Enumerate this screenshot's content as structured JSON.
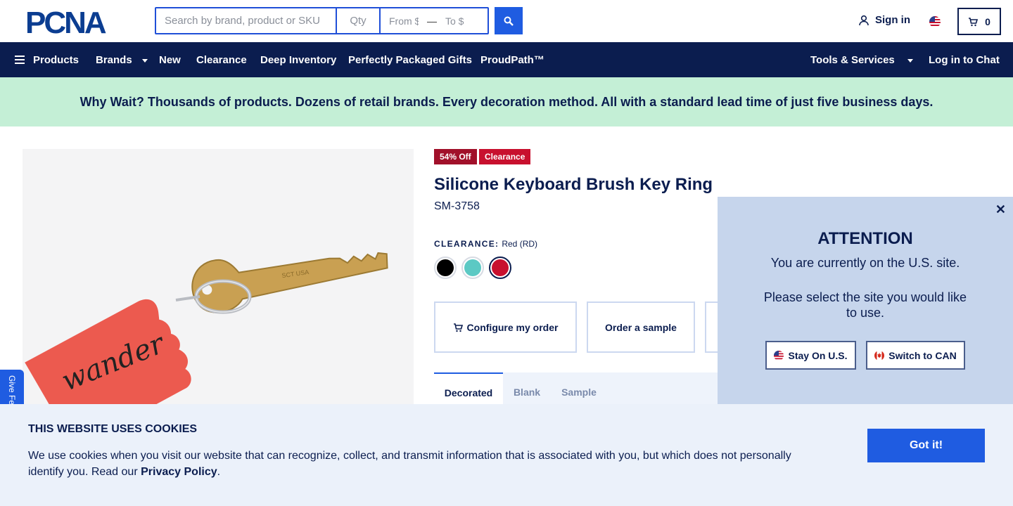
{
  "header": {
    "logo_text": "PCNA",
    "search_placeholder": "Search by brand, product or SKU",
    "qty_placeholder": "Qty",
    "from_placeholder": "From $",
    "range_separator": "—",
    "to_placeholder": "To $",
    "signin_label": "Sign in",
    "cart_count": "0"
  },
  "nav": {
    "products": "Products",
    "brands": "Brands",
    "new": "New",
    "clearance": "Clearance",
    "deep_inventory": "Deep Inventory",
    "gifts": "Perfectly Packaged Gifts",
    "proudpath": "ProudPath™",
    "tools": "Tools & Services",
    "chat": "Log in to Chat"
  },
  "banner": {
    "text": "Why Wait? Thousands of products. Dozens of retail brands. Every decoration method. All with a standard lead time of just five business days."
  },
  "product": {
    "badge_discount": "54% Off",
    "badge_clearance": "Clearance",
    "title": "Silicone Keyboard Brush Key Ring",
    "sku": "SM-3758",
    "color_label": "CLEARANCE:",
    "color_value": "Red (RD)",
    "swatches": [
      {
        "name": "Black",
        "color": "#000000"
      },
      {
        "name": "Teal",
        "color": "#5cc9c4"
      },
      {
        "name": "Red",
        "color": "#c8102e"
      }
    ],
    "image_imprint": "wander",
    "key_stamp": "SCT USA",
    "buttons": {
      "configure": "Configure my order",
      "sample": "Order a sample"
    },
    "tabs": [
      "Decorated",
      "Blank",
      "Sample"
    ]
  },
  "feedback": {
    "label": "Give Feedback"
  },
  "site_modal": {
    "heading": "ATTENTION",
    "line1": "You are currently on the U.S. site.",
    "line2": "Please select the site you would like to use.",
    "stay_label": "Stay On U.S.",
    "switch_label": "Switch to CAN"
  },
  "cookie": {
    "title": "THIS WEBSITE USES COOKIES",
    "text": "We use cookies when you visit our website that can recognize, collect, and transmit information that is associated with you, but which does not personally identify you. Read our",
    "link": "Privacy Policy",
    "end": ".",
    "button": "Got it!"
  },
  "colors": {
    "navy": "#0b1d4f",
    "accent_blue": "#1f5ce1",
    "banner_green": "#c4efd6",
    "badge_red": "#c8102e",
    "badge_dark_red": "#a1102a"
  }
}
